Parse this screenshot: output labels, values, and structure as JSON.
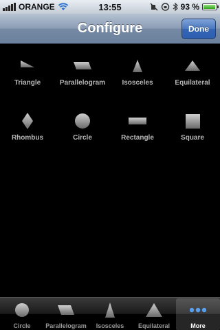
{
  "status": {
    "carrier": "ORANGE",
    "time": "13:55",
    "battery": "93 %",
    "battery_level": 0.93
  },
  "nav": {
    "title": "Configure",
    "done_label": "Done"
  },
  "shapes": [
    {
      "label": "Triangle",
      "icon": "right-triangle-icon"
    },
    {
      "label": "Parallelogram",
      "icon": "parallelogram-icon"
    },
    {
      "label": "Isosceles",
      "icon": "isosceles-triangle-icon"
    },
    {
      "label": "Equilateral",
      "icon": "equilateral-triangle-icon"
    },
    {
      "label": "Rhombus",
      "icon": "rhombus-icon"
    },
    {
      "label": "Circle",
      "icon": "circle-icon"
    },
    {
      "label": "Rectangle",
      "icon": "rectangle-icon"
    },
    {
      "label": "Square",
      "icon": "square-icon"
    }
  ],
  "tabs": [
    {
      "label": "Circle",
      "icon": "circle-icon"
    },
    {
      "label": "Parallelogram",
      "icon": "parallelogram-icon"
    },
    {
      "label": "Isosceles",
      "icon": "isosceles-triangle-icon"
    },
    {
      "label": "Equilateral",
      "icon": "equilateral-triangle-icon"
    },
    {
      "label": "More",
      "icon": "more-dots-icon",
      "selected": true
    }
  ],
  "colors": {
    "shape_fill_top": "#c8c8c8",
    "shape_fill_bottom": "#6e6e6e",
    "more_dots": "#5aa0f0"
  }
}
